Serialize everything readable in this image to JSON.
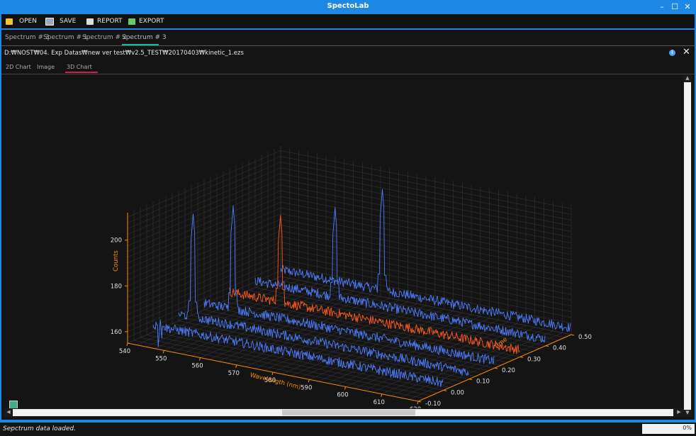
{
  "window": {
    "title": "SpectoLab"
  },
  "toolbar": {
    "open_label": "OPEN",
    "save_label": "SAVE",
    "report_label": "REPORT",
    "export_label": "EXPORT"
  },
  "doc_tabs": [
    "Spectrum # 3",
    "Spectrum # 1",
    "Spectrum # 2",
    "Spectrum # 3"
  ],
  "file_path": "D:₩NOST₩04. Exp Datas₩new ver test₩v2.5_TEST₩20170403₩kinetic_1.ezs",
  "view_tabs": [
    "2D Chart",
    "Image",
    "3D Chart"
  ],
  "chart_data": {
    "type": "3d-line",
    "xlabel": "Wavelength (nm)",
    "ylabel": "Counts",
    "zlabel": "Time",
    "x_ticks": [
      "540",
      "550",
      "560",
      "570",
      "580",
      "590",
      "600",
      "610",
      "620"
    ],
    "y_ticks": [
      "160",
      "180",
      "200"
    ],
    "z_ticks": [
      "-0.10",
      "0.00",
      "0.10",
      "0.20",
      "0.30",
      "0.40",
      "0.50"
    ],
    "xlim": [
      540,
      620
    ],
    "ylim": [
      155,
      212
    ],
    "zlim": [
      -0.1,
      0.5
    ],
    "series": [
      {
        "time": 0.0,
        "color": "#4f7cff",
        "peak_wl": 542,
        "peak_val": 161,
        "baseline": 158
      },
      {
        "time": 0.1,
        "color": "#4f7cff",
        "peak_wl": 544,
        "peak_val": 203,
        "baseline": 158
      },
      {
        "time": 0.2,
        "color": "#4f7cff",
        "peak_wl": 548,
        "peak_val": 203,
        "baseline": 158
      },
      {
        "time": 0.3,
        "color": "#ff5a1f",
        "peak_wl": 554,
        "peak_val": 196,
        "baseline": 158
      },
      {
        "time": 0.4,
        "color": "#4f7cff",
        "peak_wl": 562,
        "peak_val": 197,
        "baseline": 158
      },
      {
        "time": 0.5,
        "color": "#4f7cff",
        "peak_wl": 568,
        "peak_val": 202,
        "baseline": 158
      }
    ]
  },
  "colors": {
    "accent": "#1e88e5",
    "tab_active": "#14b8a6",
    "view_tab_active": "#d0204a",
    "axis_label": "#ff8c00"
  },
  "status": {
    "message": "Sepctrum data loaded.",
    "progress": "0%",
    "progress_value": 0
  }
}
